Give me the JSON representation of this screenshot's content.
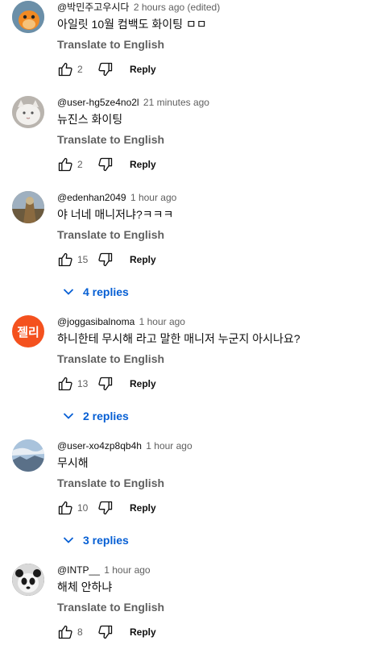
{
  "translate_label": "Translate to English",
  "reply_label": "Reply",
  "comments": [
    {
      "author": "@박민주고우시다",
      "time": "2 hours ago (edited)",
      "text": "아일릿 10월 컴백도 화이팅 ㅁㅁ",
      "likes": "2",
      "avatar": {
        "kind": "image",
        "icon": "orange-creature-icon",
        "bg": "#6b8fa8",
        "fg": "#f08a24"
      }
    },
    {
      "author": "@user-hg5ze4no2l",
      "time": "21 minutes ago",
      "text": "뉴진스 화이팅",
      "likes": "2",
      "avatar": {
        "kind": "image",
        "icon": "white-cat-icon",
        "bg": "#c9c5c0",
        "fg": "#f2f0ed"
      }
    },
    {
      "author": "@edenhan2049",
      "time": "1 hour ago",
      "text": "야 너네 매니저냐?ㅋㅋㅋ",
      "likes": "15",
      "replies": "4 replies",
      "avatar": {
        "kind": "image",
        "icon": "photo-icon",
        "bg": "#8a7a5a",
        "fg": "#c9b48a"
      }
    },
    {
      "author": "@joggasibalnoma",
      "time": "1 hour ago",
      "text": "하니한테 무시해 라고 말한 매니저 누군지 아시나요?",
      "likes": "13",
      "replies": "2 replies",
      "avatar": {
        "kind": "text",
        "label": "젤리",
        "bg": "#f4511e",
        "fg": "#ffffff"
      }
    },
    {
      "author": "@user-xo4zp8qb4h",
      "time": "1 hour ago",
      "text": "무시해",
      "likes": "10",
      "replies": "3 replies",
      "avatar": {
        "kind": "image",
        "icon": "sky-landscape-icon",
        "bg": "#8fb0cf",
        "fg": "#5a7088"
      }
    },
    {
      "author": "@INTP__",
      "time": "1 hour ago",
      "text": "해체 안하냐",
      "likes": "8",
      "avatar": {
        "kind": "image",
        "icon": "panda-icon",
        "bg": "#2a2a2a",
        "fg": "#f5f5f5"
      }
    }
  ]
}
